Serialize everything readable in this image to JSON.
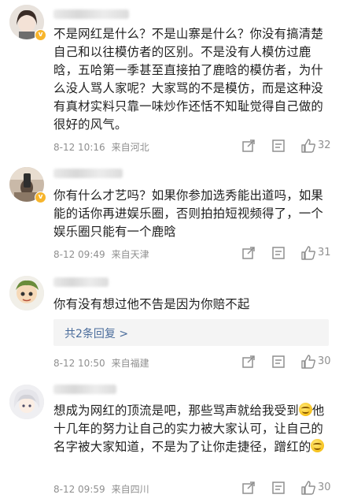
{
  "comments": [
    {
      "text": "不是网红是什么？不是山寨是什么？你没有搞清楚自己和以往模仿者的区别。不是没有人模仿过鹿晗，五哈第一季甚至直接拍了鹿晗的模仿者，为什么没人骂人家呢？大家骂的不是模仿，而是这种没有真材实料只靠一味炒作还恬不知耻觉得自己做的很好的风气。",
      "date": "8-12 10:16",
      "location": "来自河北",
      "likes": "32",
      "avatar_icon": "girl-avatar-icon"
    },
    {
      "text": "你有什么才艺吗？如果你参加选秀能出道吗，如果能的话你再进娱乐圈，否则拍拍短视频得了，一个娱乐圈只能有一个鹿晗",
      "date": "8-12 09:49",
      "location": "来自天津",
      "likes": "31",
      "avatar_icon": "selfie-avatar-icon"
    },
    {
      "text": "你有没有想过他不告是因为你赔不起",
      "date": "8-12 10:50",
      "location": "来自福建",
      "likes": "30",
      "reply_label": "共2条回复 >",
      "avatar_icon": "cartoon-avatar-icon"
    },
    {
      "text_part1": "想成为网红的顶流是吧，那些骂声就给我受到",
      "text_part2": "他十几年的努力让自己的实力被大家认可，让自己的名字被大家知道，不是为了让你走捷径，蹭红的",
      "emoji": "smile-emoji-icon",
      "date": "8-12 09:59",
      "location": "来自四川",
      "likes": "30",
      "avatar_icon": "anime-avatar-icon"
    }
  ],
  "colors": {
    "text": "#1f1f1f",
    "meta": "#8f8f8f",
    "reply_link": "#4a6c9b",
    "badge": "#f7b52c"
  }
}
